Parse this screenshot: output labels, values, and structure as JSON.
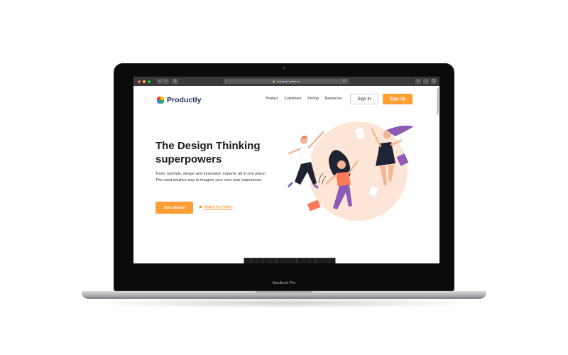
{
  "device": {
    "brand_label": "MacBook Pro"
  },
  "browser": {
    "url": "bchiang7.github.io",
    "icons": [
      "back-icon",
      "forward-icon",
      "sidebar-icon",
      "reader-icon",
      "lock-icon",
      "reload-icon",
      "download-icon",
      "share-icon",
      "tabs-icon"
    ]
  },
  "site": {
    "logo_text": "Productly",
    "nav": [
      "Product",
      "Customers",
      "Pricing",
      "Resources"
    ],
    "signin_label": "Sign In",
    "signup_label": "Sign Up",
    "hero": {
      "title": "The Design Thinking superpowers",
      "description": "Tools, tutorials, design and innovation experts, all in one place! The most intuitive way to imagine your next user experience.",
      "primary_label": "Get started",
      "secondary_label": "Watch the Video"
    }
  },
  "colors": {
    "accent": "#ff9f36",
    "title": "#1c1c1c",
    "logo": "#1f2c4a",
    "illustration_bg": "#fde6d8",
    "purple": "#8c5bb5",
    "dark": "#1f2333"
  }
}
